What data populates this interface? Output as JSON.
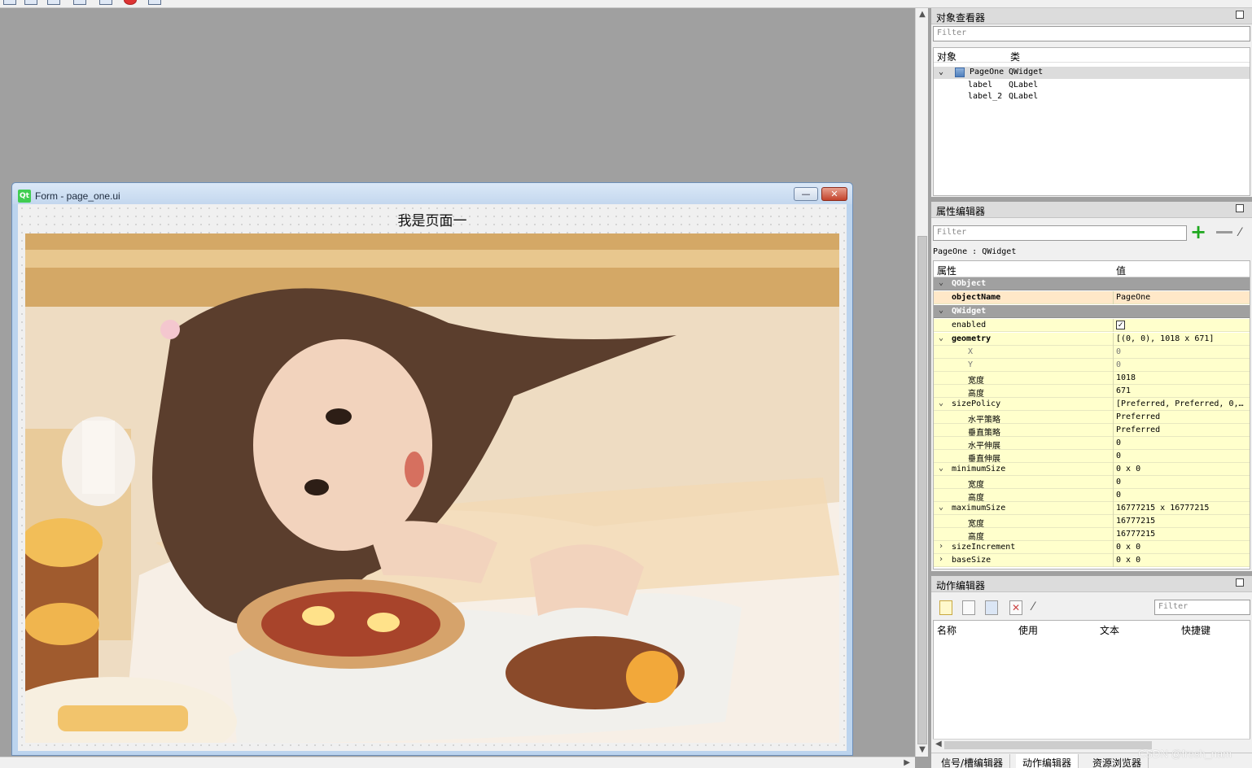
{
  "form_window": {
    "title": "Form - page_one.ui",
    "logo": "Qt",
    "minimize_glyph": "—",
    "close_glyph": "✕",
    "heading_label": "我是页面一",
    "photo_description_icon": "image-icon"
  },
  "object_inspector": {
    "title": "对象查看器",
    "filter_placeholder": "Filter",
    "columns": [
      "对象",
      "类"
    ],
    "rows": [
      {
        "object": "PageOne",
        "class": "QWidget"
      },
      {
        "object": "label",
        "class": "QLabel"
      },
      {
        "object": "label_2",
        "class": "QLabel"
      }
    ]
  },
  "property_editor": {
    "title": "属性编辑器",
    "filter_placeholder": "Filter",
    "context": "PageOne : QWidget",
    "columns": [
      "属性",
      "值"
    ],
    "rows": [
      {
        "name": "QObject",
        "value": "",
        "type": "group"
      },
      {
        "name": "objectName",
        "value": "PageOne"
      },
      {
        "name": "QWidget",
        "value": "",
        "type": "group"
      },
      {
        "name": "enabled",
        "value": "✓"
      },
      {
        "name": "geometry",
        "value": "[(0, 0), 1018 x 671]"
      },
      {
        "name": "X",
        "value": "0"
      },
      {
        "name": "Y",
        "value": "0"
      },
      {
        "name": "宽度",
        "value": "1018"
      },
      {
        "name": "高度",
        "value": "671"
      },
      {
        "name": "sizePolicy",
        "value": "[Preferred, Preferred, 0,…"
      },
      {
        "name": "水平策略",
        "value": "Preferred"
      },
      {
        "name": "垂直策略",
        "value": "Preferred"
      },
      {
        "name": "水平伸展",
        "value": "0"
      },
      {
        "name": "垂直伸展",
        "value": "0"
      },
      {
        "name": "minimumSize",
        "value": "0 x 0"
      },
      {
        "name": "宽度",
        "value": "0"
      },
      {
        "name": "高度",
        "value": "0"
      },
      {
        "name": "maximumSize",
        "value": "16777215 x 16777215"
      },
      {
        "name": "宽度",
        "value": "16777215"
      },
      {
        "name": "高度",
        "value": "16777215"
      },
      {
        "name": "sizeIncrement",
        "value": "0 x 0"
      },
      {
        "name": "baseSize",
        "value": "0 x 0"
      }
    ]
  },
  "action_editor": {
    "title": "动作编辑器",
    "filter_placeholder": "Filter",
    "columns": [
      "名称",
      "使用",
      "文本",
      "快捷键"
    ]
  },
  "bottom_tabs": [
    "信号/槽编辑器",
    "动作编辑器",
    "资源浏览器"
  ],
  "watermark": "CSDN @fresh_nam",
  "colors": {
    "canvas": "#a0a0a0",
    "property_row": "#ffffcc",
    "property_group": "#a0a0a0",
    "selected_row": "#ffe8c8"
  }
}
